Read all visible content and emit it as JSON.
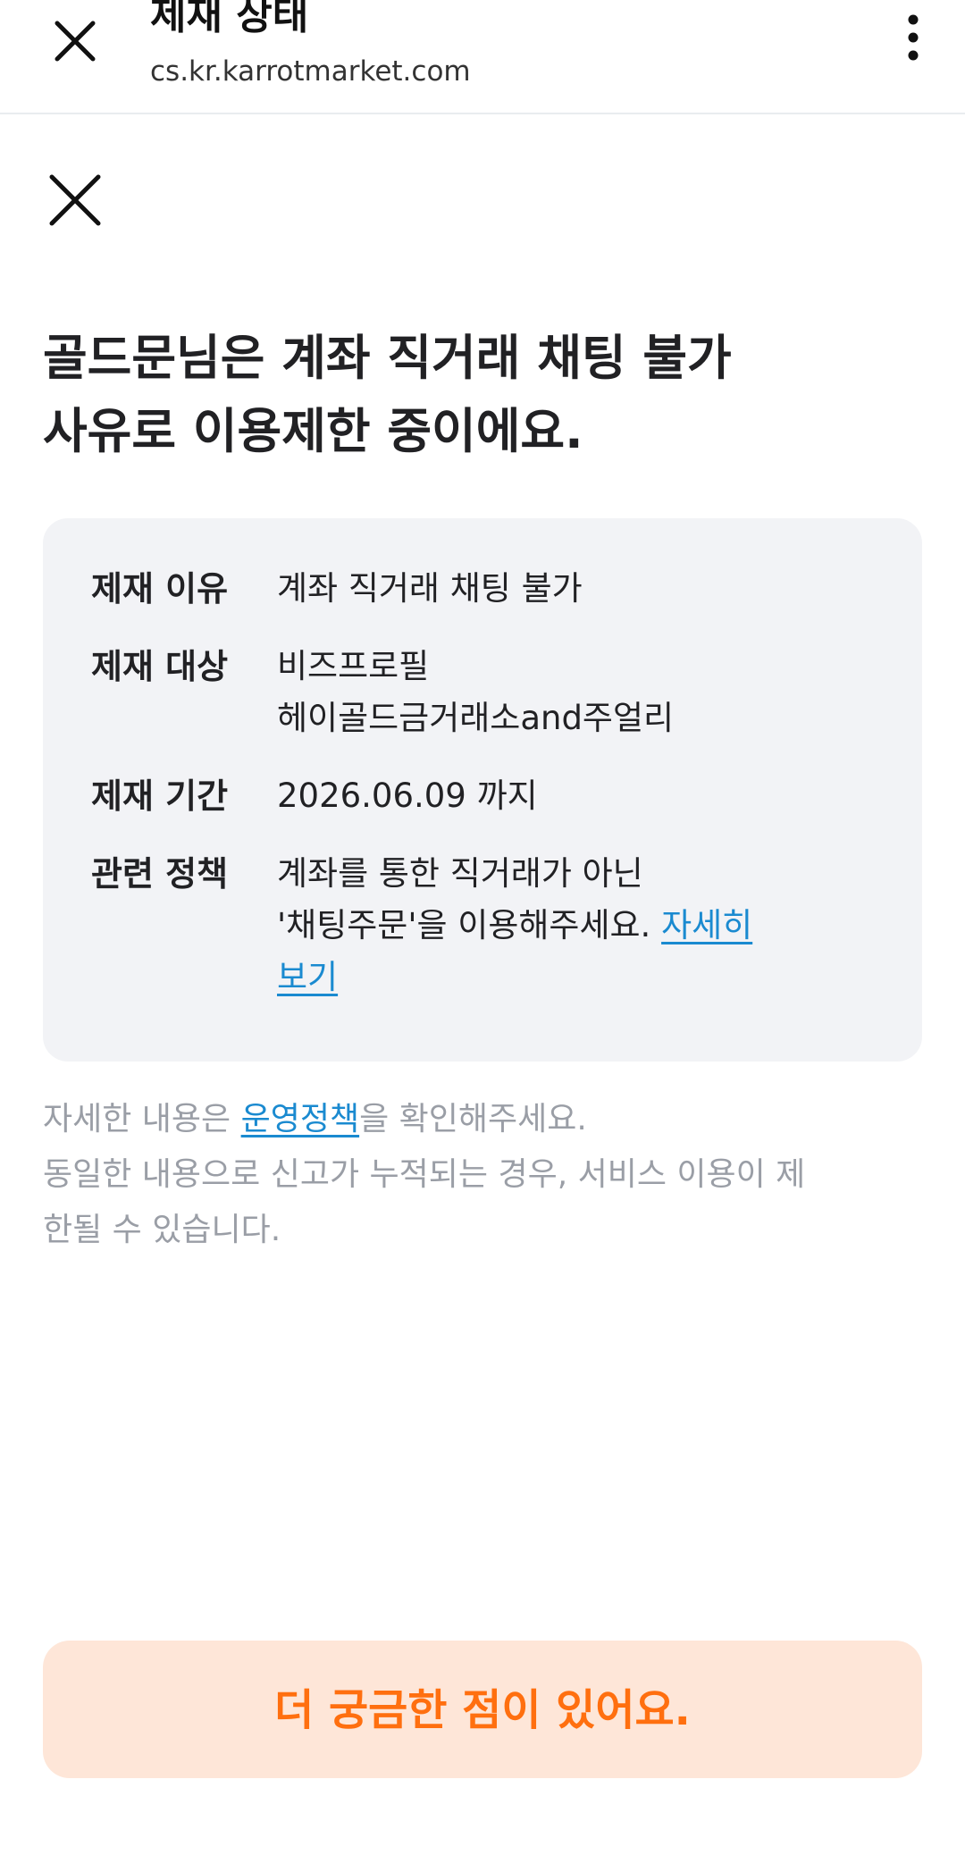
{
  "browser": {
    "title": "제재 상태",
    "url": "cs.kr.karrotmarket.com",
    "close_icon": "close-icon",
    "menu_icon": "more-vertical-icon"
  },
  "page": {
    "close_icon": "close-icon",
    "headline_line1": "골드문님은 계좌 직거래 채팅 불가",
    "headline_line2": "사유로 이용제한 중이에요."
  },
  "sanction": {
    "reason_label": "제재 이유",
    "reason_value": "계좌 직거래 채팅 불가",
    "target_label": "제재 대상",
    "target_value_line1": "비즈프로필",
    "target_value_line2": "헤이골드금거래소and주얼리",
    "period_label": "제재 기간",
    "period_value": "2026.06.09 까지",
    "policy_label": "관련 정책",
    "policy_line1": "계좌를 통한 직거래가 아닌",
    "policy_line2": "'채팅주문'을 이용해주세요.",
    "policy_link_part1": "자세히",
    "policy_link_part2": "보기"
  },
  "notes": {
    "line1_prefix": "자세한 내용은 ",
    "line1_link": "운영정책",
    "line1_suffix": "을 확인해주세요.",
    "line2": "동일한 내용으로 신고가 누적되는 경우, 서비스 이용이 제",
    "line3": "한될 수 있습니다."
  },
  "cta": {
    "label": "더 궁금한 점이 있어요."
  },
  "colors": {
    "accent": "#ff6f0f",
    "accent_bg": "#fee6d8",
    "link": "#1a8ad0",
    "card_bg": "#f2f3f6",
    "muted_text": "#9a9ea6"
  }
}
